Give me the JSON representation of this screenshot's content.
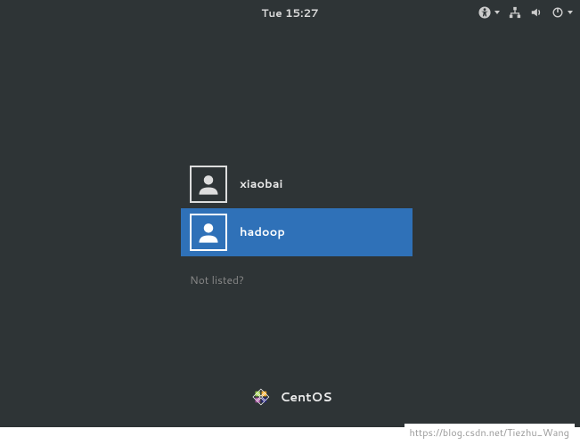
{
  "topbar": {
    "clock": "Tue 15:27",
    "icons": {
      "accessibility": "accessibility-icon",
      "network": "network-icon",
      "volume": "volume-icon",
      "power": "power-icon"
    }
  },
  "users": [
    {
      "name": "xiaobai",
      "selected": false
    },
    {
      "name": "hadoop",
      "selected": true
    }
  ],
  "not_listed_label": "Not listed?",
  "branding": {
    "os_name": "CentOS"
  },
  "watermark": "https://blog.csdn.net/Tiezhu_Wang"
}
